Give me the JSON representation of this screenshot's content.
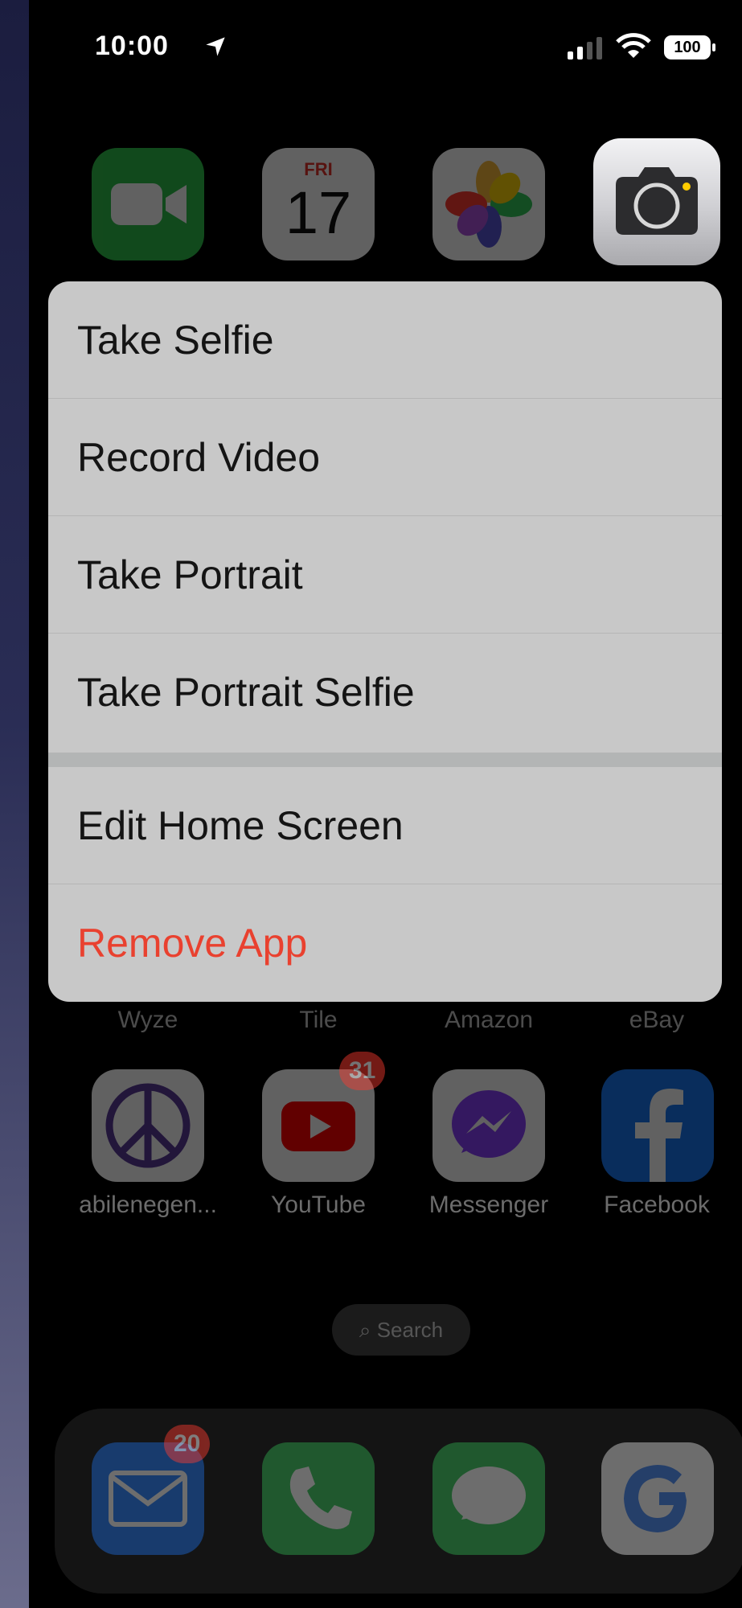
{
  "status_bar": {
    "time": "10:00",
    "battery": "100"
  },
  "home_row1": [
    {
      "label": "FaceTime"
    },
    {
      "label": "Calendar",
      "day": "FRI",
      "date": "17"
    },
    {
      "label": "Photos"
    },
    {
      "label": "Camera"
    }
  ],
  "context_menu": {
    "items": [
      {
        "label": "Take Selfie"
      },
      {
        "label": "Record Video"
      },
      {
        "label": "Take Portrait"
      },
      {
        "label": "Take Portrait Selfie"
      }
    ],
    "secondary": [
      {
        "label": "Edit Home Screen"
      },
      {
        "label": "Remove App"
      }
    ],
    "destructive_color": "#e9412f"
  },
  "home_row2_labels": [
    "Wyze",
    "Tile",
    "Amazon",
    "eBay"
  ],
  "home_row3": [
    {
      "label": "abilenegen..."
    },
    {
      "label": "YouTube",
      "badge": "31"
    },
    {
      "label": "Messenger"
    },
    {
      "label": "Facebook"
    }
  ],
  "search": {
    "label": "Search"
  },
  "dock": [
    {
      "name": "Mail",
      "badge": "20"
    },
    {
      "name": "Phone"
    },
    {
      "name": "Messages"
    },
    {
      "name": "Google"
    }
  ]
}
